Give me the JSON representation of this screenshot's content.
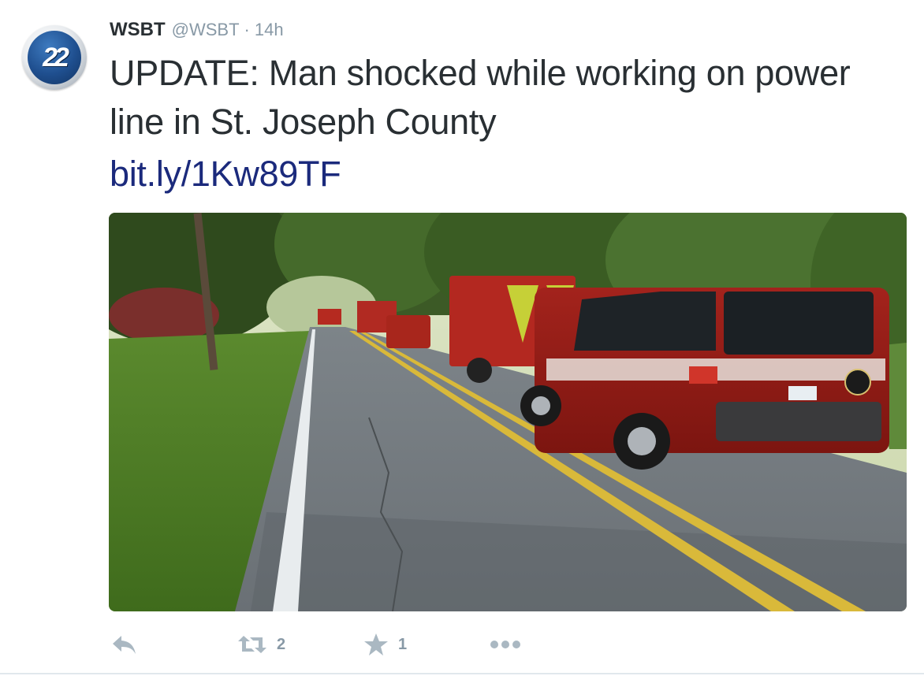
{
  "author": {
    "display_name": "WSBT",
    "handle": "@WSBT",
    "separator": "·",
    "time": "14h",
    "avatar_text": "22"
  },
  "tweet": {
    "text": "UPDATE: Man shocked while working on power line in St. Joseph County",
    "link": "bit.ly/1Kw89TF"
  },
  "actions": {
    "reply_icon": "reply-icon",
    "retweet_icon": "retweet-icon",
    "retweet_count": "2",
    "favorite_icon": "star-icon",
    "favorite_count": "1",
    "more_icon": "more-dots-icon"
  },
  "colors": {
    "text": "#292f33",
    "muted": "#8899a6",
    "link": "#1b2a7c",
    "icon": "#aab8c2"
  }
}
